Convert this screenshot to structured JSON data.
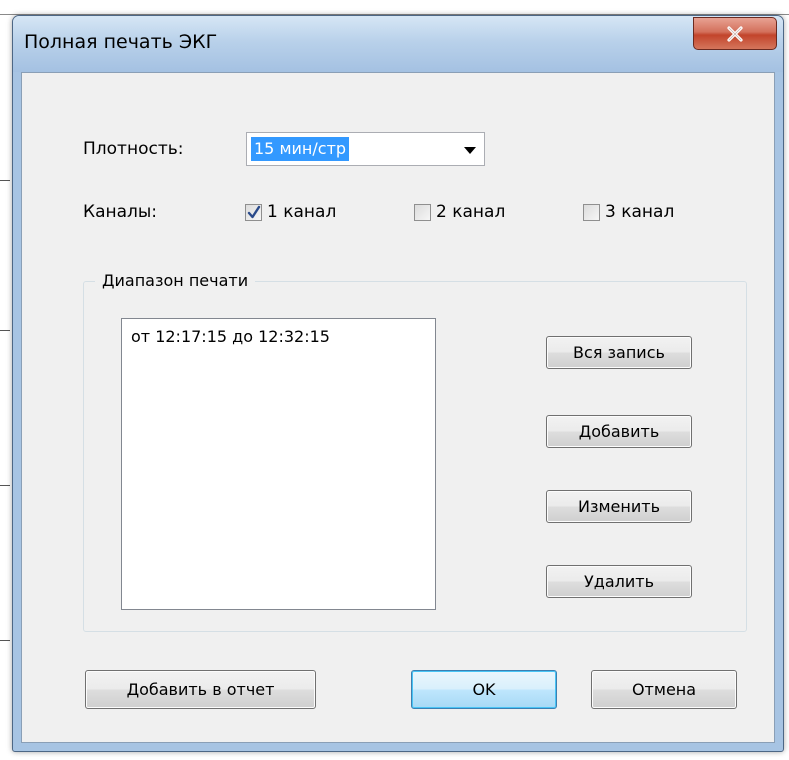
{
  "window": {
    "title": "Полная печать ЭКГ",
    "close_symbol": "x"
  },
  "density": {
    "label": "Плотность:",
    "selected": "15 мин/стр"
  },
  "channels": {
    "label": "Каналы:",
    "options": [
      {
        "label": "1 канал",
        "checked": true
      },
      {
        "label": "2 канал",
        "checked": false
      },
      {
        "label": "3 канал",
        "checked": false
      }
    ]
  },
  "print_range": {
    "legend": "Диапазон печати",
    "items": [
      "от 12:17:15 до 12:32:15"
    ],
    "buttons": {
      "all": "Вся запись",
      "add": "Добавить",
      "edit": "Изменить",
      "delete": "Удалить"
    }
  },
  "footer": {
    "add_to_report": "Добавить в отчет",
    "ok": "OK",
    "cancel": "Отмена"
  },
  "icons": {
    "close": "close-icon",
    "dropdown": "chevron-down-icon",
    "check": "checkmark-icon"
  },
  "colors": {
    "selection": "#3399ff",
    "close_button": "#c2442b",
    "window_frame": "#a7c4e3",
    "client_bg": "#f0f0f0"
  }
}
